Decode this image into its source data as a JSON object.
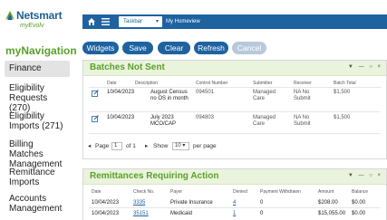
{
  "brand": {
    "name": "Netsmart",
    "sub": "myEvolv",
    "colors": {
      "primary": "#1e62a0",
      "accent_green": "#5aa02c"
    }
  },
  "sidebar": {
    "title": "myNavigation",
    "items": [
      {
        "label": "Finance",
        "active": true
      },
      {
        "label": "Eligibility Requests (270)"
      },
      {
        "label": "Eligibility Imports (271)"
      },
      {
        "label": "Billing Matches Management"
      },
      {
        "label": "Remittance Imports"
      },
      {
        "label": "Accounts Management"
      }
    ]
  },
  "topbar": {
    "home_icon": "home-icon",
    "menu_icon": "hamburger-icon",
    "taskbar_label": "Taskbar",
    "homeview_label": "My Homeview"
  },
  "actions": {
    "widgets": "Widgets",
    "save": "Save",
    "clear": "Clear",
    "refresh": "Refresh",
    "cancel": "Cancel"
  },
  "batches": {
    "title": "Batches Not Sent",
    "tools": "▼ — ○ ×",
    "columns": [
      "Date",
      "Description",
      "Control Number",
      "Submitter",
      "Receiver",
      "Batch Total"
    ],
    "rows": [
      {
        "date": "10/04/2023",
        "description": "August Census no OS in month",
        "control": "094501",
        "submitter": "Managed Care",
        "receiver": "NA No Submit",
        "total": "$1,500"
      },
      {
        "date": "10/04/2023",
        "description": "July 2023 MCO/CAP",
        "control": "094803",
        "submitter": "Managed Care",
        "receiver": "NA No Submit",
        "total": "$1,500"
      }
    ],
    "pager": {
      "page_label": "Page",
      "page": "1",
      "of_label": "of 1",
      "show_label": "Show",
      "show_value": "10",
      "per_page_label": "per page"
    }
  },
  "remittances": {
    "title": "Remittances Requiring Action",
    "tools": "▼ — ○ ×",
    "columns": [
      "Date",
      "Check No.",
      "Payer",
      "Denied",
      "Payment Withdrawn",
      "Amount",
      "Balance"
    ],
    "rows": [
      {
        "date": "10/04/2023",
        "check": "3335",
        "payer": "Private Insurance",
        "denied": "4",
        "withdrawn": "0",
        "amount": "$208.00",
        "balance": "$0.00"
      },
      {
        "date": "10/04/2023",
        "check": "35151",
        "payer": "Medicaid",
        "denied": "1",
        "withdrawn": "0",
        "amount": "$15,055.00",
        "balance": "$0.00"
      }
    ]
  }
}
